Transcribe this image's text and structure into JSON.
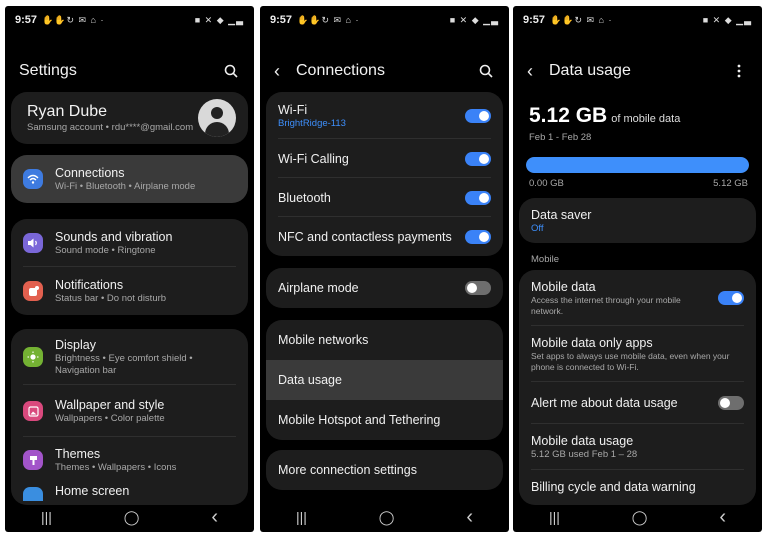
{
  "status": {
    "time": "9:57",
    "icons_left": "✋✋↻ ✉ ⌂ ·",
    "icons_right": "■ ✕ ◆ ▁▃"
  },
  "nav": {
    "recents": "|||",
    "home": "◯",
    "back": "‹"
  },
  "settings": {
    "title": "Settings",
    "profile": {
      "name": "Ryan Dube",
      "account": "Samsung account • rdu****@gmail.com"
    },
    "items": [
      {
        "label": "Connections",
        "sub": "Wi-Fi • Bluetooth • Airplane mode",
        "color": "#3e7be0"
      },
      {
        "label": "Sounds and vibration",
        "sub": "Sound mode • Ringtone",
        "color": "#7a67d8"
      },
      {
        "label": "Notifications",
        "sub": "Status bar • Do not disturb",
        "color": "#e2604f"
      },
      {
        "label": "Display",
        "sub": "Brightness • Eye comfort shield • Navigation bar",
        "color": "#74b233"
      },
      {
        "label": "Wallpaper and style",
        "sub": "Wallpapers • Color palette",
        "color": "#d9497d"
      },
      {
        "label": "Themes",
        "sub": "Themes • Wallpapers • Icons",
        "color": "#a254c9"
      },
      {
        "label": "Home screen",
        "color": "#3a8ee0"
      }
    ]
  },
  "connections": {
    "title": "Connections",
    "wifi": {
      "label": "Wi-Fi",
      "network": "BrightRidge-113",
      "on": true
    },
    "wifi_calling": {
      "label": "Wi-Fi Calling",
      "on": true
    },
    "bluetooth": {
      "label": "Bluetooth",
      "on": true
    },
    "nfc": {
      "label": "NFC and contactless payments",
      "on": true
    },
    "airplane": {
      "label": "Airplane mode",
      "on": false
    },
    "mobile_networks": "Mobile networks",
    "data_usage": "Data usage",
    "hotspot": "Mobile Hotspot and Tethering",
    "more": "More connection settings"
  },
  "data_usage": {
    "title": "Data usage",
    "amount": "5.12 GB",
    "amount_suffix": "of mobile data",
    "period": "Feb 1 - Feb 28",
    "usage_fraction": 1.0,
    "bar_min": "0.00 GB",
    "bar_max": "5.12 GB",
    "data_saver": {
      "label": "Data saver",
      "value": "Off"
    },
    "section_mobile": "Mobile",
    "mobile_data": {
      "label": "Mobile data",
      "sub": "Access the internet through your mobile network.",
      "on": true
    },
    "only_apps": {
      "label": "Mobile data only apps",
      "sub": "Set apps to always use mobile data, even when your phone is connected to Wi-Fi."
    },
    "alert": {
      "label": "Alert me about data usage",
      "on": false
    },
    "mobile_usage": {
      "label": "Mobile data usage",
      "sub": "5.12 GB used Feb 1 – 28"
    },
    "billing": {
      "label": "Billing cycle and data warning"
    }
  },
  "colors": {
    "accent": "#3a82f7",
    "card": "#1d1d1d",
    "selected": "#3a3a3a"
  }
}
